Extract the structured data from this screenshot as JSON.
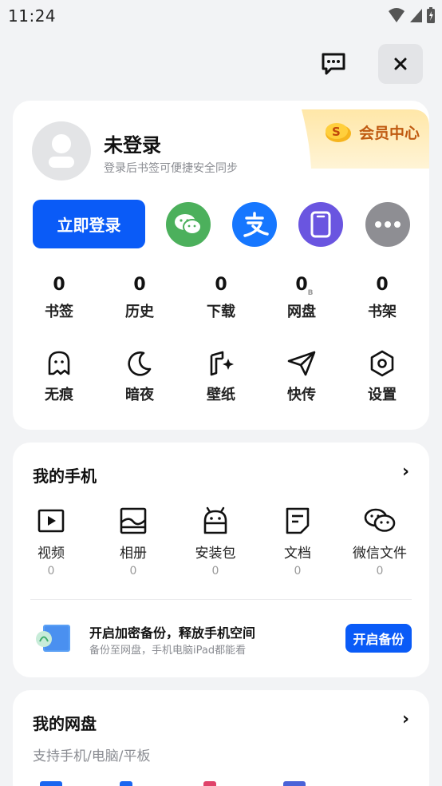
{
  "status_bar": {
    "time": "11:24"
  },
  "vip": {
    "label": "会员中心"
  },
  "profile": {
    "name": "未登录",
    "subtitle": "登录后书签可便捷安全同步",
    "login_label": "立即登录"
  },
  "stats": [
    {
      "value": "0",
      "unit": "",
      "label": "书签"
    },
    {
      "value": "0",
      "unit": "",
      "label": "历史"
    },
    {
      "value": "0",
      "unit": "",
      "label": "下载"
    },
    {
      "value": "0",
      "unit": "B",
      "label": "网盘"
    },
    {
      "value": "0",
      "unit": "",
      "label": "书架"
    }
  ],
  "tools": [
    {
      "label": "无痕",
      "icon": "ghost-icon"
    },
    {
      "label": "暗夜",
      "icon": "moon-icon"
    },
    {
      "label": "壁纸",
      "icon": "wallpaper-icon"
    },
    {
      "label": "快传",
      "icon": "send-icon"
    },
    {
      "label": "设置",
      "icon": "settings-icon"
    }
  ],
  "phone": {
    "title": "我的手机",
    "chevron": "›",
    "items": [
      {
        "label": "视频",
        "count": "0",
        "icon": "video-icon"
      },
      {
        "label": "相册",
        "count": "0",
        "icon": "album-icon"
      },
      {
        "label": "安装包",
        "count": "0",
        "icon": "apk-icon"
      },
      {
        "label": "文档",
        "count": "0",
        "icon": "document-icon"
      },
      {
        "label": "微信文件",
        "count": "0",
        "icon": "wechat-file-icon"
      }
    ],
    "backup": {
      "title": "开启加密备份，释放手机空间",
      "subtitle": "备份至网盘，手机电脑iPad都能看",
      "button": "开启备份"
    }
  },
  "cloud": {
    "title": "我的网盘",
    "chevron": "›",
    "subtitle": "支持手机/电脑/平板"
  },
  "colors": {
    "primary": "#0a5bf7",
    "wechat": "#4cb05c",
    "alipay": "#1677ff",
    "device": "#6a55e0",
    "more": "#8e8e93",
    "vip": "#c05a10"
  }
}
